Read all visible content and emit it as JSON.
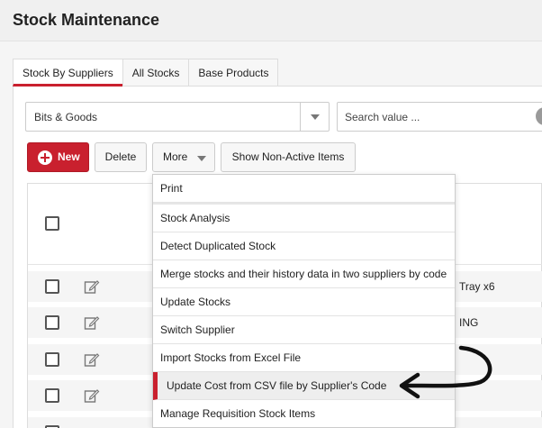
{
  "page": {
    "title": "Stock Maintenance"
  },
  "tabs": [
    {
      "label": "Stock By Suppliers",
      "active": true
    },
    {
      "label": "All Stocks",
      "active": false
    },
    {
      "label": "Base Products",
      "active": false
    }
  ],
  "filter": {
    "supplier_value": "Bits & Goods",
    "search_placeholder": "Search value ..."
  },
  "toolbar": {
    "new_label": "New",
    "delete_label": "Delete",
    "more_label": "More",
    "show_nonactive_label": "Show Non-Active Items"
  },
  "grid": {
    "rows": [
      {
        "cell": "Tray x6"
      },
      {
        "cell": "ING"
      },
      {
        "cell": ""
      },
      {
        "cell": ""
      }
    ]
  },
  "more_menu": {
    "items": [
      {
        "label": "Print"
      },
      {
        "label": "Stock Analysis"
      },
      {
        "label": "Detect Duplicated Stock"
      },
      {
        "label": "Merge stocks and their history data in two suppliers by code"
      },
      {
        "label": "Update Stocks"
      },
      {
        "label": "Switch Supplier"
      },
      {
        "label": "Import Stocks from Excel File"
      },
      {
        "label": "Update Cost from CSV file by Supplier's Code",
        "highlighted": true
      },
      {
        "label": "Manage Requisition Stock Items"
      }
    ]
  },
  "colors": {
    "accent": "#c9202e",
    "annotation_arrow": "#111111"
  },
  "icons": {
    "row_edit": "edit-icon",
    "new": "plus-circle-icon",
    "caret": "chevron-down-icon",
    "search": "search-icon"
  }
}
